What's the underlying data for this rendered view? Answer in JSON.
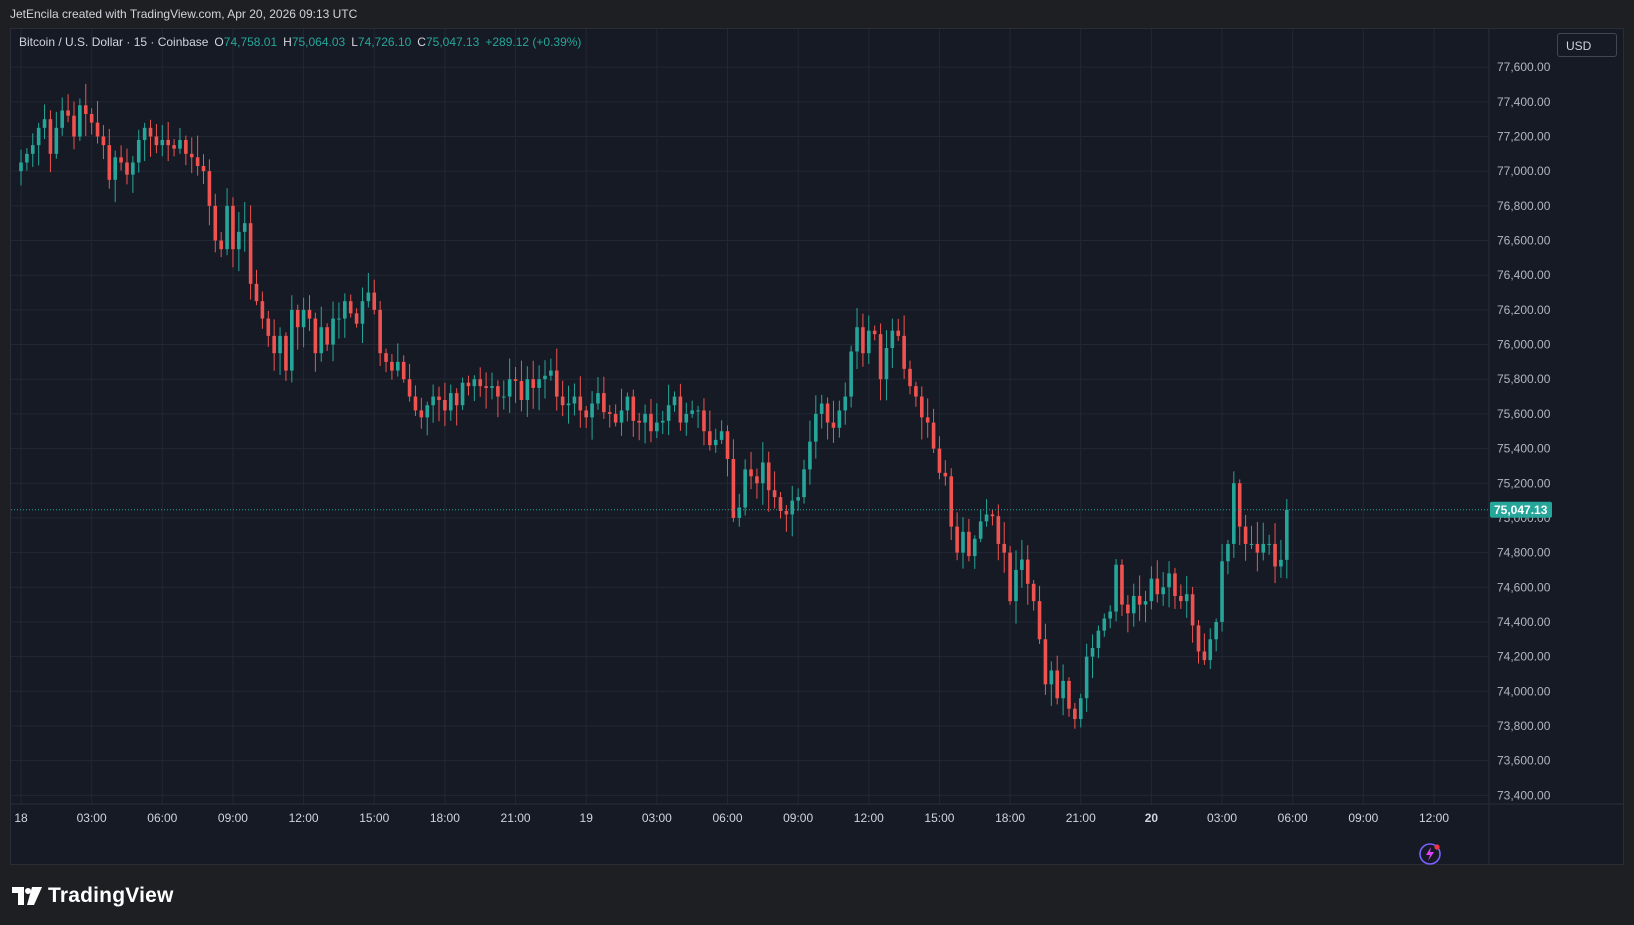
{
  "header": {
    "credit": "JetEncila created with TradingView.com, Apr 20, 2026 09:13 UTC"
  },
  "legend": {
    "symbol": "Bitcoin / U.S. Dollar · 15 · Coinbase",
    "open_label": "O",
    "open": "74,758.01",
    "high_label": "H",
    "high": "75,064.03",
    "low_label": "L",
    "low": "74,726.10",
    "close_label": "C",
    "close": "75,047.13",
    "change": "+289.12 (+0.39%)"
  },
  "currency_button": "USD",
  "brand": {
    "name": "TradingView"
  },
  "icons": {
    "lightning": "lightning-icon",
    "logo": "tradingview-logo-icon"
  },
  "colors": {
    "up": "#26a69a",
    "down": "#ef5350",
    "background": "#161a25",
    "grid": "#232733",
    "last_price": "#26a69a"
  },
  "chart_data": {
    "type": "candlestick",
    "last_price": 75047.13,
    "last_price_label": "75,047.13",
    "ylim": [
      73350,
      77820
    ],
    "xlim": [
      0,
      211
    ],
    "y_ticks": [
      {
        "value": 77600,
        "label": "77,600.00"
      },
      {
        "value": 77400,
        "label": "77,400.00"
      },
      {
        "value": 77200,
        "label": "77,200.00"
      },
      {
        "value": 77000,
        "label": "77,000.00"
      },
      {
        "value": 76800,
        "label": "76,800.00"
      },
      {
        "value": 76600,
        "label": "76,600.00"
      },
      {
        "value": 76400,
        "label": "76,400.00"
      },
      {
        "value": 76200,
        "label": "76,200.00"
      },
      {
        "value": 76000,
        "label": "76,000.00"
      },
      {
        "value": 75800,
        "label": "75,800.00"
      },
      {
        "value": 75600,
        "label": "75,600.00"
      },
      {
        "value": 75400,
        "label": "75,400.00"
      },
      {
        "value": 75200,
        "label": "75,200.00"
      },
      {
        "value": 75000,
        "label": "75,000.00"
      },
      {
        "value": 74800,
        "label": "74,800.00"
      },
      {
        "value": 74600,
        "label": "74,600.00"
      },
      {
        "value": 74400,
        "label": "74,400.00"
      },
      {
        "value": 74200,
        "label": "74,200.00"
      },
      {
        "value": 74000,
        "label": "74,000.00"
      },
      {
        "value": 73800,
        "label": "73,800.00"
      },
      {
        "value": 73600,
        "label": "73,600.00"
      },
      {
        "value": 73400,
        "label": "73,400.00"
      }
    ],
    "x_ticks": [
      {
        "index": 0,
        "label": "18",
        "bold": false
      },
      {
        "index": 12,
        "label": "03:00",
        "bold": false
      },
      {
        "index": 24,
        "label": "06:00",
        "bold": false
      },
      {
        "index": 36,
        "label": "09:00",
        "bold": false
      },
      {
        "index": 48,
        "label": "12:00",
        "bold": false
      },
      {
        "index": 60,
        "label": "15:00",
        "bold": false
      },
      {
        "index": 72,
        "label": "18:00",
        "bold": false
      },
      {
        "index": 84,
        "label": "21:00",
        "bold": false
      },
      {
        "index": 96,
        "label": "19",
        "bold": false
      },
      {
        "index": 108,
        "label": "03:00",
        "bold": false
      },
      {
        "index": 120,
        "label": "06:00",
        "bold": false
      },
      {
        "index": 132,
        "label": "09:00",
        "bold": false
      },
      {
        "index": 144,
        "label": "12:00",
        "bold": false
      },
      {
        "index": 156,
        "label": "15:00",
        "bold": false
      },
      {
        "index": 168,
        "label": "18:00",
        "bold": false
      },
      {
        "index": 180,
        "label": "21:00",
        "bold": false
      },
      {
        "index": 192,
        "label": "20",
        "bold": true
      },
      {
        "index": 204,
        "label": "03:00",
        "bold": false
      },
      {
        "index": 216,
        "label": "06:00",
        "bold": false
      },
      {
        "index": 228,
        "label": "09:00",
        "bold": false
      },
      {
        "index": 240,
        "label": "12:00",
        "bold": false
      }
    ],
    "close": [
      77050,
      77100,
      77150,
      77250,
      77300,
      77100,
      77250,
      77350,
      77320,
      77200,
      77380,
      77330,
      77280,
      77200,
      77150,
      76950,
      77080,
      77050,
      76980,
      77050,
      77180,
      77250,
      77200,
      77150,
      77180,
      77150,
      77130,
      77180,
      77100,
      77080,
      77030,
      77000,
      76800,
      76600,
      76550,
      76800,
      76550,
      76650,
      76700,
      76350,
      76250,
      76150,
      76050,
      75950,
      76050,
      75850,
      76200,
      76100,
      76200,
      76150,
      75950,
      76100,
      76000,
      76150,
      76150,
      76250,
      76180,
      76120,
      76250,
      76300,
      76200,
      75950,
      75900,
      75850,
      75900,
      75800,
      75700,
      75620,
      75580,
      75650,
      75700,
      75680,
      75620,
      75720,
      75650,
      75780,
      75760,
      75800,
      75760,
      75750,
      75760,
      75700,
      75700,
      75800,
      75790,
      75680,
      75800,
      75750,
      75800,
      75820,
      75850,
      75700,
      75650,
      75660,
      75700,
      75620,
      75580,
      75660,
      75720,
      75610,
      75600,
      75550,
      75620,
      75700,
      75560,
      75550,
      75600,
      75500,
      75550,
      75560,
      75650,
      75700,
      75550,
      75600,
      75620,
      75620,
      75500,
      75420,
      75450,
      75500,
      75340,
      75000,
      75060,
      75280,
      75240,
      75200,
      75320,
      75160,
      75120,
      75040,
      75020,
      75100,
      75120,
      75280,
      75440,
      75600,
      75660,
      75550,
      75520,
      75620,
      75700,
      75960,
      76100,
      75950,
      76080,
      76060,
      75800,
      75980,
      76080,
      76050,
      75860,
      75760,
      75700,
      75580,
      75550,
      75400,
      75260,
      75240,
      74950,
      74800,
      74920,
      74780,
      74880,
      74980,
      75020,
      75010,
      74850,
      74800,
      74520,
      74700,
      74760,
      74620,
      74520,
      74300,
      74040,
      74120,
      73960,
      74060,
      73900,
      73840,
      73960,
      74200,
      74250,
      74350,
      74420,
      74460,
      74730,
      74500,
      74450,
      74550,
      74500,
      74520,
      74650,
      74560,
      74600,
      74680,
      74550,
      74520,
      74560,
      74380,
      74230,
      74180,
      74300,
      74400,
      74750,
      74850,
      75200,
      74950,
      74850,
      74850,
      74800,
      74850,
      74850,
      74720,
      74758,
      75047
    ],
    "range_note": "Candles: 15-minute OHLC, index 0 = Apr 18 00:00 UTC; only close series listed, open = previous close"
  }
}
